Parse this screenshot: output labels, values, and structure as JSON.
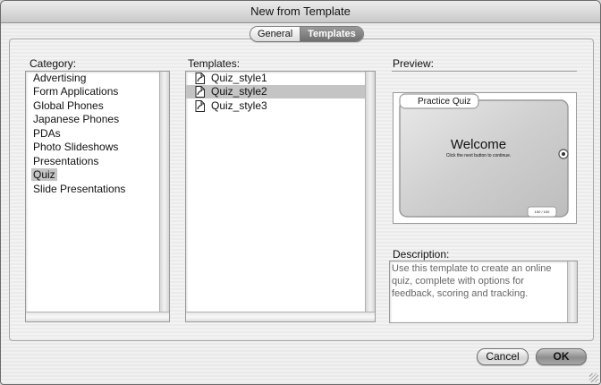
{
  "window": {
    "title": "New from Template"
  },
  "tabs": [
    {
      "label": "General",
      "active": false
    },
    {
      "label": "Templates",
      "active": true
    }
  ],
  "category": {
    "label": "Category:",
    "items": [
      "Advertising",
      "Form Applications",
      "Global Phones",
      "Japanese Phones",
      "PDAs",
      "Photo Slideshows",
      "Presentations",
      "Quiz",
      "Slide Presentations"
    ],
    "selected": "Quiz"
  },
  "templates": {
    "label": "Templates:",
    "items": [
      "Quiz_style1",
      "Quiz_style2",
      "Quiz_style3"
    ],
    "selected": "Quiz_style2",
    "icon": "flash-document-icon"
  },
  "preview": {
    "label": "Preview:",
    "tab_title": "Practice Quiz",
    "heading": "Welcome",
    "subtext": "Click the next button to continue.",
    "counter": "100 / 100"
  },
  "description": {
    "label": "Description:",
    "text": "Use this template to create an online quiz, complete with options for feedback, scoring and tracking."
  },
  "buttons": {
    "cancel": "Cancel",
    "ok": "OK"
  },
  "colors": {
    "selection": "#c4c4c4",
    "default_button": "#8d8d8d"
  }
}
